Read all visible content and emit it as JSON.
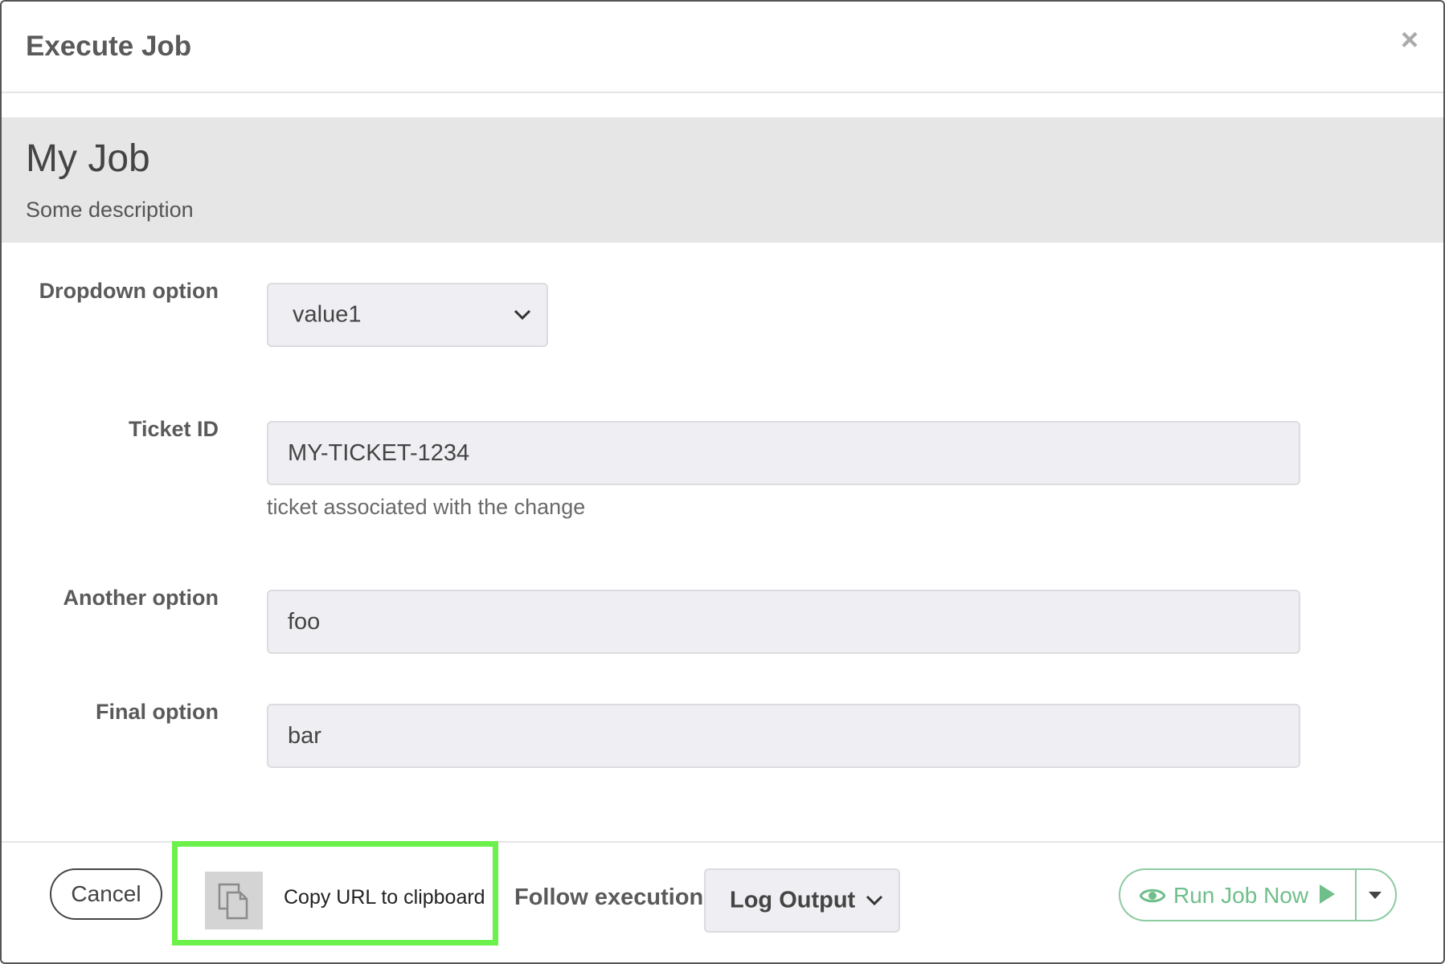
{
  "header": {
    "title": "Execute Job",
    "close_symbol": "×"
  },
  "job": {
    "name": "My Job",
    "description": "Some description"
  },
  "options": {
    "dropdown": {
      "label": "Dropdown option",
      "selected": "value1"
    },
    "ticket": {
      "label": "Ticket ID",
      "value": "MY-TICKET-1234",
      "help": "ticket associated with the change"
    },
    "another": {
      "label": "Another option",
      "value": "foo"
    },
    "final": {
      "label": "Final option",
      "value": "bar"
    }
  },
  "footer": {
    "cancel_label": "Cancel",
    "copy_url_label": "Copy URL to clipboard",
    "follow_label": "Follow execution",
    "follow_selected": "Log Output",
    "run_label": "Run Job Now",
    "icons": {
      "copy": "copy-icon",
      "eye": "eye-icon",
      "play": "play-icon",
      "caret": "caret-down-icon"
    }
  },
  "colors": {
    "run_accent": "#6fbf8a",
    "highlight": "#6cf04c",
    "banner_bg": "#e6e6e6",
    "input_bg": "#efeff3"
  }
}
